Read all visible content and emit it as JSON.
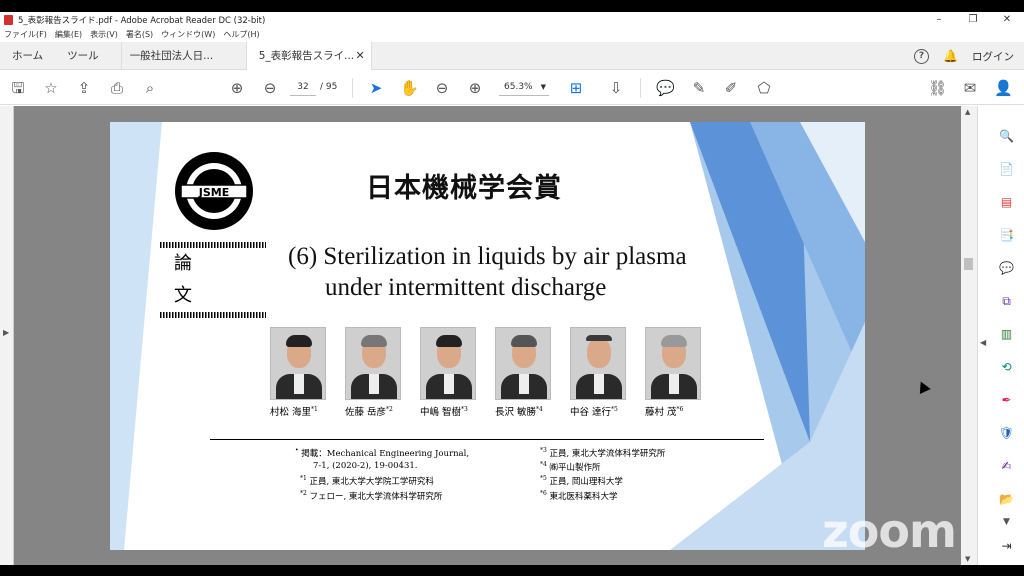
{
  "window": {
    "title": "5_表彰報告スライド.pdf - Adobe Acrobat Reader DC (32-bit)",
    "controls": {
      "minimize": "–",
      "maximize": "❐",
      "close": "✕"
    }
  },
  "menu": [
    "ファイル(F)",
    "編集(E)",
    "表示(V)",
    "署名(S)",
    "ウィンドウ(W)",
    "ヘルプ(H)"
  ],
  "tabs": {
    "home": "ホーム",
    "tools": "ツール",
    "doc1": "一般社団法人日...",
    "doc2": "5_表彰報告スライ...",
    "close": "✕",
    "help": "?",
    "login": "ログイン"
  },
  "toolbar": {
    "page_current": "32",
    "page_total": "/ 95",
    "zoom": "65.3%"
  },
  "slide": {
    "logo_text": "JSME",
    "category": "論文",
    "award": "日本機械学会賞",
    "title_line1": "(6) Sterilization in liquids by air plasma",
    "title_line2": "under intermittent discharge",
    "authors": [
      {
        "name": "村松 海里",
        "mark": "*1"
      },
      {
        "name": "佐藤 岳彦",
        "mark": "*2"
      },
      {
        "name": "中嶋 智樹",
        "mark": "*3"
      },
      {
        "name": "長沢 敏勝",
        "mark": "*4"
      },
      {
        "name": "中谷 達行",
        "mark": "*5"
      },
      {
        "name": "藤村 茂",
        "mark": "*6"
      }
    ],
    "notes_left": [
      {
        "mark": "•",
        "text": "掲載：Mechanical Engineering Journal,"
      },
      {
        "mark": "",
        "text": "7-1, (2020-2), 19-00431."
      },
      {
        "mark": "*1",
        "text": "正員, 東北大学大学院工学研究科"
      },
      {
        "mark": "*2",
        "text": "フェロー, 東北大学流体科学研究所"
      }
    ],
    "notes_right": [
      {
        "mark": "*3",
        "text": "正員, 東北大学流体科学研究所"
      },
      {
        "mark": "*4",
        "text": "㈱平山製作所"
      },
      {
        "mark": "*5",
        "text": "正員, 岡山理科大学"
      },
      {
        "mark": "*6",
        "text": "東北医科薬科大学"
      }
    ]
  },
  "watermark": "zoom"
}
